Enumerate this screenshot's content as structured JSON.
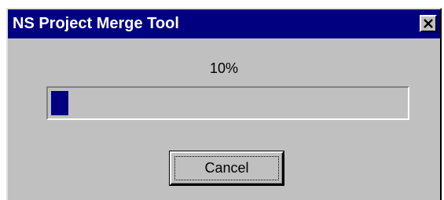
{
  "window": {
    "title": "NS Project Merge Tool",
    "close_icon": "close-icon"
  },
  "progress": {
    "percent_label": "10%",
    "value_fraction": 0.1,
    "block_color": "#000080"
  },
  "buttons": {
    "cancel_label": "Cancel"
  },
  "colors": {
    "titlebar": "#000080",
    "face": "#c0c0c0"
  }
}
